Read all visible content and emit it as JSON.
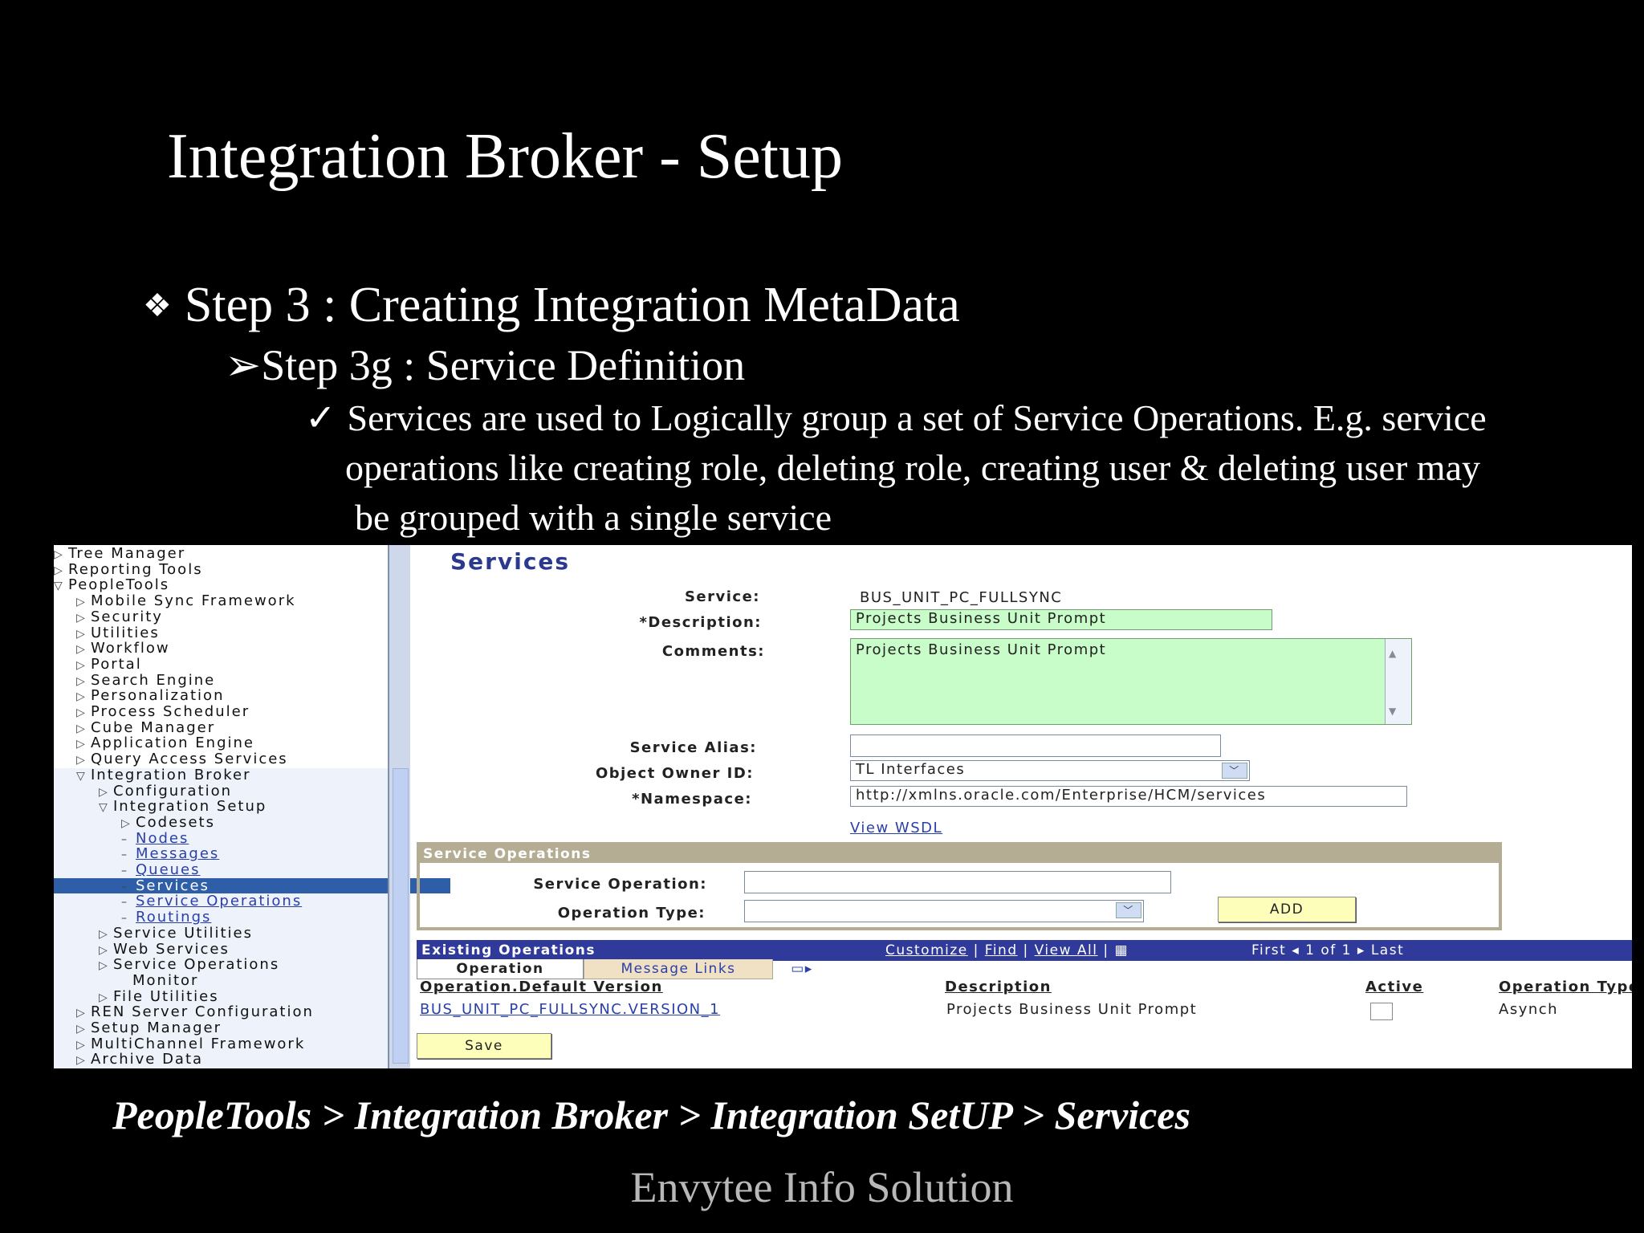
{
  "slide": {
    "title": "Integration Broker - Setup",
    "step_bullet": "❖",
    "step": "Step 3 : Creating Integration MetaData",
    "substep": "➢Step 3g : Service Definition",
    "check": "✓",
    "detail_line1": "Services are used to Logically group a set of Service Operations. E.g. service",
    "detail_line2": "operations like creating role, deleting role, creating user & deleting user may",
    "detail_line3": "be grouped with a single service",
    "path": "PeopleTools > Integration Broker > Integration SetUP > Services",
    "footer": "Envytee Info Solution"
  },
  "nav": {
    "items": [
      {
        "label": "Tree Manager",
        "tri": "▷"
      },
      {
        "label": "Reporting Tools",
        "tri": "▷"
      },
      {
        "label": "PeopleTools",
        "tri": "▽"
      },
      {
        "label": "Mobile Sync Framework",
        "tri": "▷"
      },
      {
        "label": "Security",
        "tri": "▷"
      },
      {
        "label": "Utilities",
        "tri": "▷"
      },
      {
        "label": "Workflow",
        "tri": "▷"
      },
      {
        "label": "Portal",
        "tri": "▷"
      },
      {
        "label": "Search Engine",
        "tri": "▷"
      },
      {
        "label": "Personalization",
        "tri": "▷"
      },
      {
        "label": "Process Scheduler",
        "tri": "▷"
      },
      {
        "label": "Cube Manager",
        "tri": "▷"
      },
      {
        "label": "Application Engine",
        "tri": "▷"
      },
      {
        "label": "Query Access Services",
        "tri": "▷"
      },
      {
        "label": "Integration Broker",
        "tri": "▽"
      },
      {
        "label": "Configuration",
        "tri": "▷"
      },
      {
        "label": "Integration Setup",
        "tri": "▽"
      },
      {
        "label": "Codesets",
        "tri": "▷"
      },
      {
        "label": "Nodes",
        "tri": "–"
      },
      {
        "label": "Messages",
        "tri": "–"
      },
      {
        "label": "Queues",
        "tri": "–"
      },
      {
        "label": "Services",
        "tri": "–"
      },
      {
        "label": "Service Operations",
        "tri": "–"
      },
      {
        "label": "Routings",
        "tri": "–"
      },
      {
        "label": "Service Utilities",
        "tri": "▷"
      },
      {
        "label": "Web Services",
        "tri": "▷"
      },
      {
        "label": "Service Operations",
        "tri": "▷"
      },
      {
        "label": "Monitor",
        "tri": ""
      },
      {
        "label": "File Utilities",
        "tri": "▷"
      },
      {
        "label": "REN Server Configuration",
        "tri": "▷"
      },
      {
        "label": "Setup Manager",
        "tri": "▷"
      },
      {
        "label": "MultiChannel Framework",
        "tri": "▷"
      },
      {
        "label": "Archive Data",
        "tri": "▷"
      }
    ]
  },
  "form": {
    "heading": "Services",
    "service_label": "Service:",
    "service_value": "BUS_UNIT_PC_FULLSYNC",
    "description_label": "*Description:",
    "description_value": "Projects Business Unit Prompt",
    "comments_label": "Comments:",
    "comments_value": "Projects Business Unit Prompt",
    "alias_label": "Service Alias:",
    "alias_value": "",
    "owner_label": "Object Owner ID:",
    "owner_value": "TL Interfaces",
    "namespace_label": "*Namespace:",
    "namespace_value": "http://xmlns.oracle.com/Enterprise/HCM/services",
    "view_wsdl": "View WSDL"
  },
  "service_operations": {
    "header": "Service Operations",
    "op_label": "Service Operation:",
    "op_value": "",
    "type_label": "Operation Type:",
    "type_value": "",
    "add_button": "ADD"
  },
  "existing": {
    "header": "Existing Operations",
    "customize": "Customize",
    "find": "Find",
    "view_all": "View All",
    "first": "First",
    "count": "1 of 1",
    "last": "Last",
    "tab_operation": "Operation",
    "tab_links": "Message Links",
    "col_operation": "Operation.Default Version",
    "col_description": "Description",
    "col_active": "Active",
    "col_type": "Operation Type",
    "row": {
      "operation": "BUS_UNIT_PC_FULLSYNC.VERSION_1",
      "description": "Projects Business Unit Prompt",
      "type": "Asynch"
    },
    "save_button": "Save"
  }
}
